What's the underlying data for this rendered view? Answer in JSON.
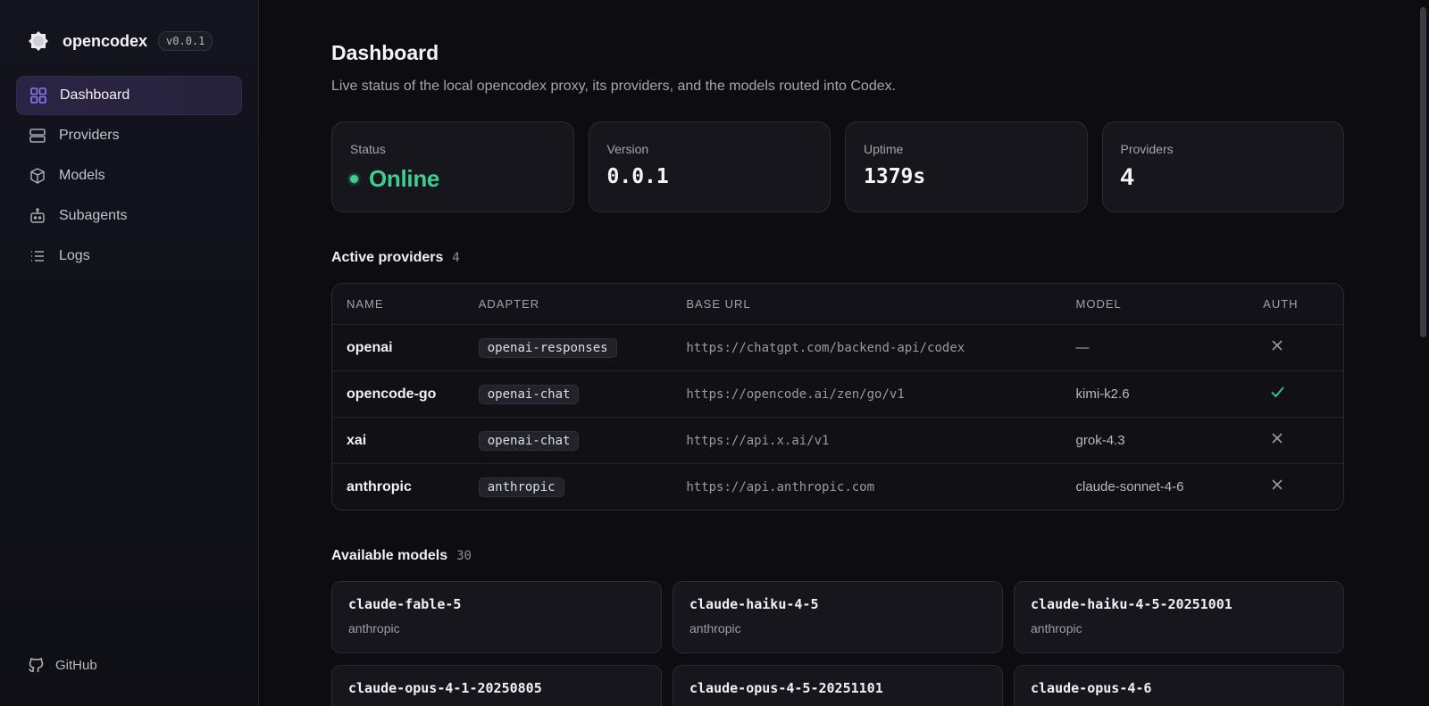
{
  "brand": {
    "name": "opencodex",
    "version": "v0.0.1"
  },
  "nav": [
    {
      "label": "Dashboard",
      "icon": "dashboard-grid-icon",
      "active": true
    },
    {
      "label": "Providers",
      "icon": "server-icon",
      "active": false
    },
    {
      "label": "Models",
      "icon": "cube-icon",
      "active": false
    },
    {
      "label": "Subagents",
      "icon": "bot-icon",
      "active": false
    },
    {
      "label": "Logs",
      "icon": "list-icon",
      "active": false
    }
  ],
  "footer": {
    "github_label": "GitHub"
  },
  "page": {
    "title": "Dashboard",
    "subtitle": "Live status of the local opencodex proxy, its providers, and the models routed into Codex."
  },
  "stats": {
    "status": {
      "label": "Status",
      "value": "Online",
      "color": "#3ecf8e"
    },
    "version": {
      "label": "Version",
      "value": "0.0.1"
    },
    "uptime": {
      "label": "Uptime",
      "value": "1379s"
    },
    "providers": {
      "label": "Providers",
      "value": "4"
    }
  },
  "active_providers": {
    "title": "Active providers",
    "count": "4",
    "columns": [
      "NAME",
      "ADAPTER",
      "BASE URL",
      "MODEL",
      "AUTH"
    ],
    "rows": [
      {
        "name": "openai",
        "adapter": "openai-responses",
        "base_url": "https://chatgpt.com/backend-api/codex",
        "model": "—",
        "auth": false
      },
      {
        "name": "opencode-go",
        "adapter": "openai-chat",
        "base_url": "https://opencode.ai/zen/go/v1",
        "model": "kimi-k2.6",
        "auth": true
      },
      {
        "name": "xai",
        "adapter": "openai-chat",
        "base_url": "https://api.x.ai/v1",
        "model": "grok-4.3",
        "auth": false
      },
      {
        "name": "anthropic",
        "adapter": "anthropic",
        "base_url": "https://api.anthropic.com",
        "model": "claude-sonnet-4-6",
        "auth": false
      }
    ]
  },
  "available_models": {
    "title": "Available models",
    "count": "30",
    "items": [
      {
        "name": "claude-fable-5",
        "provider": "anthropic"
      },
      {
        "name": "claude-haiku-4-5",
        "provider": "anthropic"
      },
      {
        "name": "claude-haiku-4-5-20251001",
        "provider": "anthropic"
      },
      {
        "name": "claude-opus-4-1-20250805",
        "provider": ""
      },
      {
        "name": "claude-opus-4-5-20251101",
        "provider": ""
      },
      {
        "name": "claude-opus-4-6",
        "provider": ""
      }
    ]
  },
  "colors": {
    "accent": "#8b7cf6",
    "success": "#3ecf8e",
    "background": "#0d0d11"
  }
}
